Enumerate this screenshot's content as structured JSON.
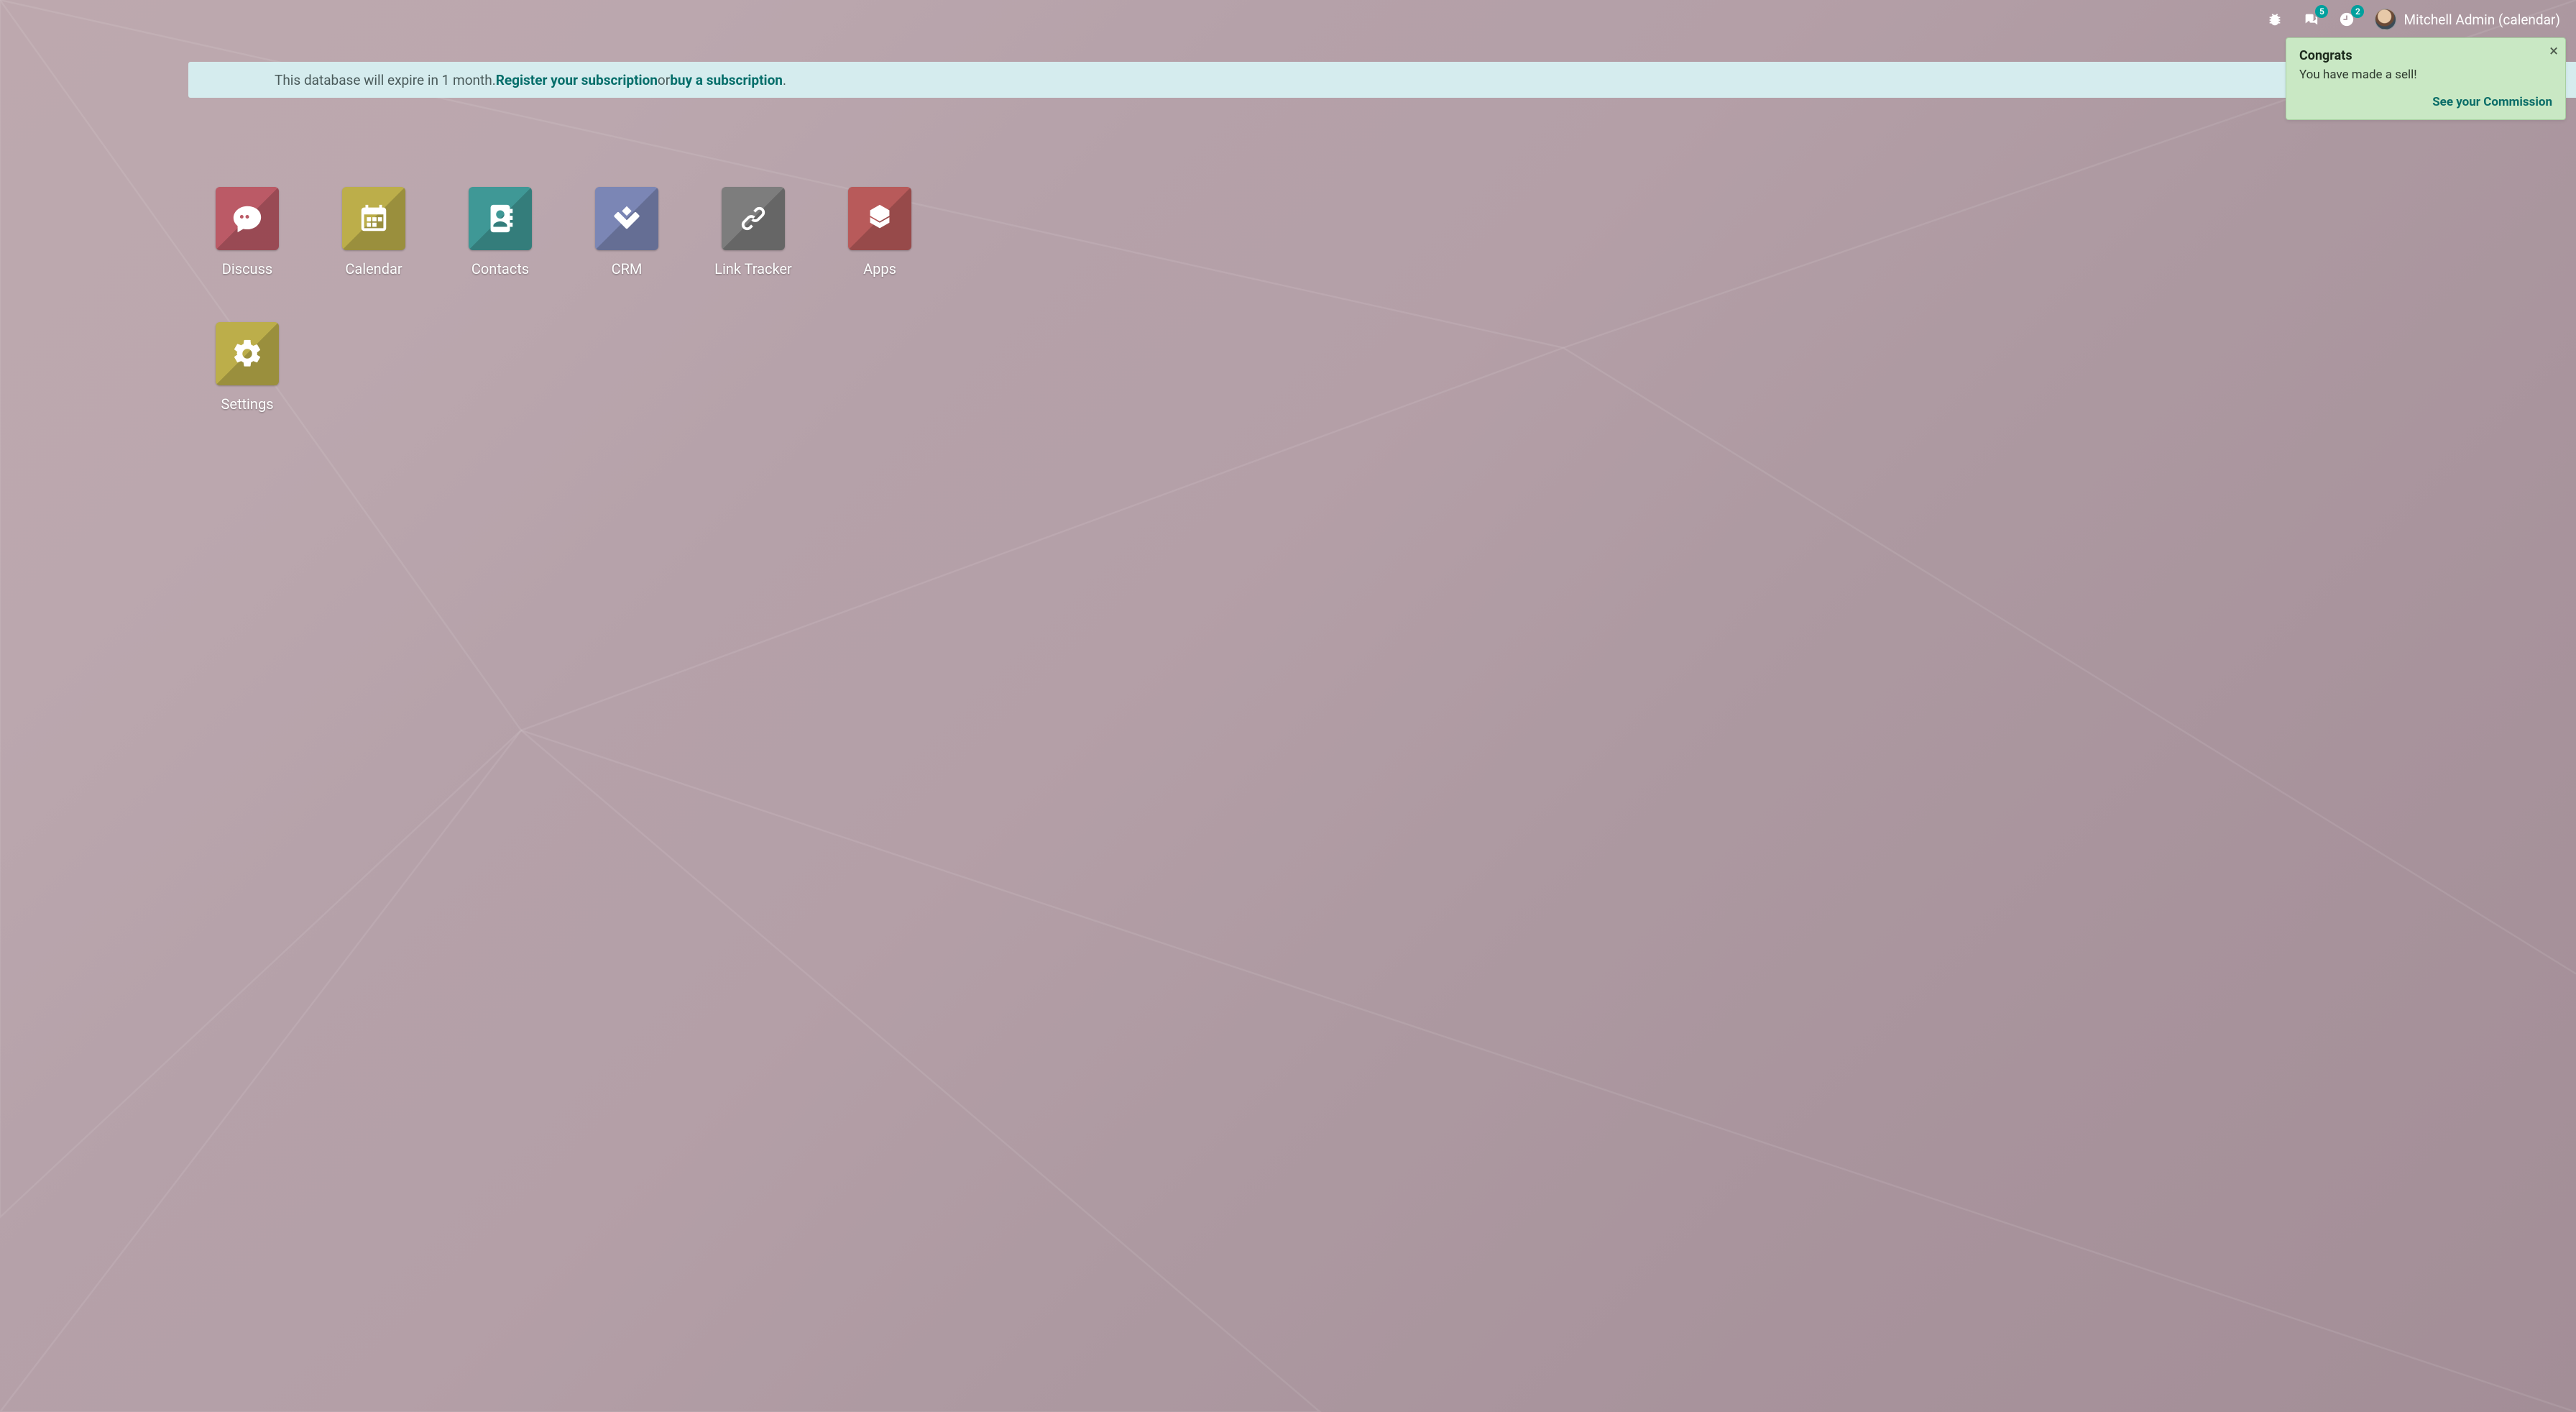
{
  "topbar": {
    "messages_badge": "5",
    "activities_badge": "2",
    "username": "Mitchell Admin (calendar)"
  },
  "banner": {
    "prefix": "This database will expire in 1 month. ",
    "register_link": "Register your subscription",
    "between": " or ",
    "buy_link": "buy a subscription",
    "suffix": "."
  },
  "toast": {
    "title": "Congrats",
    "body": "You have made a sell!",
    "action": "See your Commission"
  },
  "apps": [
    {
      "label": "Discuss",
      "color": "c-discuss",
      "icon": "discuss"
    },
    {
      "label": "Calendar",
      "color": "c-calendar",
      "icon": "calendar"
    },
    {
      "label": "Contacts",
      "color": "c-contacts",
      "icon": "contacts"
    },
    {
      "label": "CRM",
      "color": "c-crm",
      "icon": "crm"
    },
    {
      "label": "Link Tracker",
      "color": "c-link",
      "icon": "link"
    },
    {
      "label": "Apps",
      "color": "c-apps",
      "icon": "apps"
    },
    {
      "label": "Settings",
      "color": "c-settings",
      "icon": "settings"
    }
  ]
}
